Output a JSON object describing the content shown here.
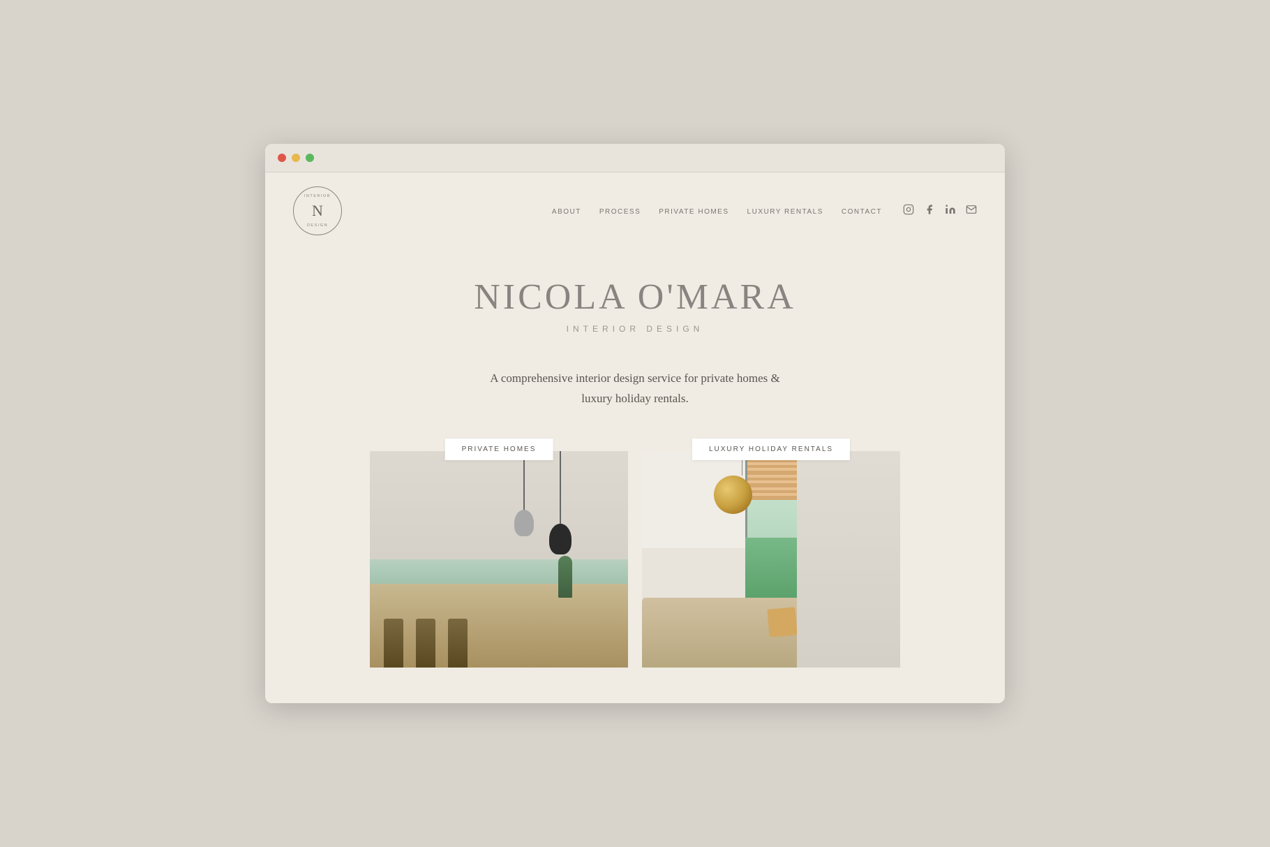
{
  "browser": {
    "dots": [
      "red",
      "yellow",
      "green"
    ]
  },
  "nav": {
    "logo": {
      "letter": "N",
      "top_text": "INTERIOR",
      "bottom_text": "DESIGN"
    },
    "links": [
      {
        "id": "about",
        "label": "ABOUT"
      },
      {
        "id": "process",
        "label": "PROCESS"
      },
      {
        "id": "private-homes",
        "label": "PRIVATE HOMES"
      },
      {
        "id": "luxury-rentals",
        "label": "LUXURY RENTALS"
      },
      {
        "id": "contact",
        "label": "CONTACT"
      }
    ],
    "social_icons": [
      {
        "id": "instagram",
        "symbol": "□",
        "label": "Instagram"
      },
      {
        "id": "facebook",
        "symbol": "f",
        "label": "Facebook"
      },
      {
        "id": "linkedin",
        "symbol": "in",
        "label": "LinkedIn"
      },
      {
        "id": "email",
        "symbol": "✉",
        "label": "Email"
      }
    ]
  },
  "hero": {
    "title": "NICOLA O'MARA",
    "subtitle": "INTERIOR DESIGN",
    "description": "A comprehensive interior design service for private homes & luxury holiday rentals."
  },
  "cards": [
    {
      "id": "private-homes",
      "label": "PRIVATE HOMES"
    },
    {
      "id": "luxury-rentals",
      "label": "LUXURY HOLIDAY RENTALS"
    }
  ],
  "colors": {
    "background": "#d8d4cc",
    "site_bg": "#f0ece4",
    "text_primary": "#5a5550",
    "text_light": "#8a8480",
    "nav_text": "#7a7570",
    "accent": "#f0ece4"
  }
}
